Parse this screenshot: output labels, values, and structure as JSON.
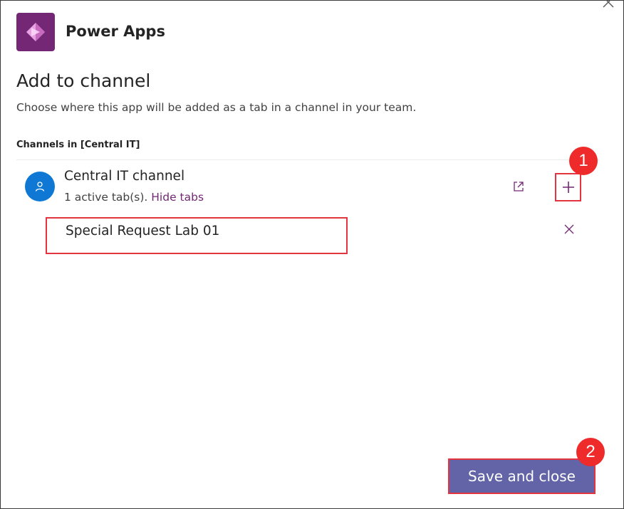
{
  "app": {
    "title": "Power Apps",
    "logo_icon": "power-apps-logo",
    "brand_color": "#742774"
  },
  "dialog": {
    "title": "Add to channel",
    "description": "Choose where this app will be added as a tab in a channel in your team.",
    "close_icon": "close-icon"
  },
  "channels": {
    "section_label": "Channels in [Central IT]",
    "items": [
      {
        "name": "Central IT channel",
        "active_tabs_text": "1 active tab(s).",
        "hide_tabs_label": "Hide tabs",
        "avatar_icon": "person-icon",
        "tabs": [
          {
            "name": "Special Request Lab 01"
          }
        ]
      }
    ]
  },
  "annotations": {
    "badge_1": "1",
    "badge_2": "2"
  },
  "footer": {
    "save_label": "Save and close",
    "button_color": "#6264a7"
  }
}
